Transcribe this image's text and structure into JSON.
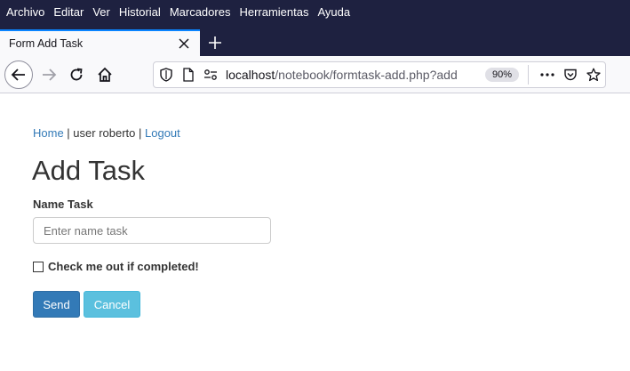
{
  "menu": {
    "items": [
      "Archivo",
      "Editar",
      "Ver",
      "Historial",
      "Marcadores",
      "Herramientas",
      "Ayuda"
    ]
  },
  "tab": {
    "title": "Form Add Task"
  },
  "urlbar": {
    "host": "localhost",
    "path": "/notebook/formtask-add.php?add",
    "zoom": "90%"
  },
  "page": {
    "nav": {
      "home": "Home",
      "user": "user roberto",
      "logout": "Logout",
      "separator": " | "
    },
    "title": "Add Task",
    "name_label": "Name Task",
    "name_placeholder": "Enter name task",
    "name_value": "",
    "checkbox_label": "Check me out if completed!",
    "checkbox_checked": false,
    "send_label": "Send",
    "cancel_label": "Cancel"
  },
  "colors": {
    "chrome_dark": "#1e2140",
    "link": "#337ab7",
    "send_button": "#337ab7",
    "cancel_button": "#5bc0de",
    "tab_accent": "#0a84ff"
  }
}
